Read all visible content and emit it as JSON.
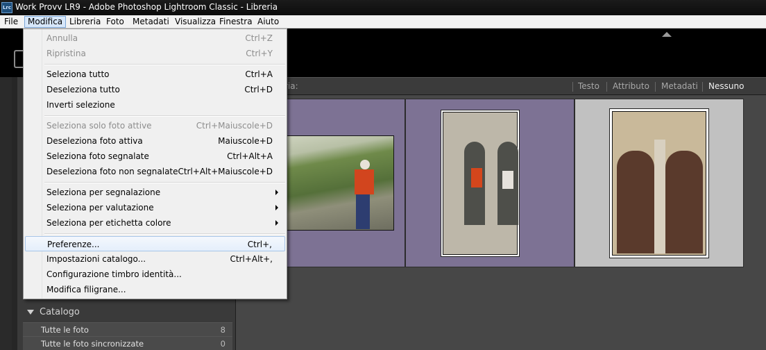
{
  "window": {
    "title": "Work Provv LR9 - Adobe Photoshop Lightroom Classic - Libreria",
    "icon_label": "Lrc"
  },
  "menubar": {
    "items": [
      "File",
      "Modifica",
      "Libreria",
      "Foto",
      "Metadati",
      "Visualizza",
      "Finestra",
      "Aiuto"
    ],
    "open": "Modifica"
  },
  "edit_menu": {
    "undo": {
      "label": "Annulla",
      "shortcut": "Ctrl+Z"
    },
    "redo": {
      "label": "Ripristina",
      "shortcut": "Ctrl+Y"
    },
    "select_all": {
      "label": "Seleziona tutto",
      "shortcut": "Ctrl+A"
    },
    "deselect_all": {
      "label": "Deseleziona tutto",
      "shortcut": "Ctrl+D"
    },
    "invert_selection": {
      "label": "Inverti selezione"
    },
    "select_active_only": {
      "label": "Seleziona solo foto attive",
      "shortcut": "Ctrl+Maiuscole+D"
    },
    "deselect_active": {
      "label": "Deseleziona foto attiva",
      "shortcut": "Maiuscole+D"
    },
    "select_flagged": {
      "label": "Seleziona foto segnalate",
      "shortcut": "Ctrl+Alt+A"
    },
    "deselect_unflagged": {
      "label": "Deseleziona foto non segnalate",
      "shortcut": "Ctrl+Alt+Maiuscole+D"
    },
    "select_by_flag": {
      "label": "Seleziona per segnalazione"
    },
    "select_by_rating": {
      "label": "Seleziona per valutazione"
    },
    "select_by_color": {
      "label": "Seleziona per etichetta colore"
    },
    "preferences": {
      "label": "Preferenze...",
      "shortcut": "Ctrl+,"
    },
    "catalog_settings": {
      "label": "Impostazioni catalogo...",
      "shortcut": "Ctrl+Alt+,"
    },
    "identity_plate": {
      "label": "Configurazione timbro identità..."
    },
    "watermarks": {
      "label": "Modifica filigrane..."
    }
  },
  "filter_bar": {
    "label": "ria:",
    "options": [
      "Testo",
      "Attributo",
      "Metadati",
      "Nessuno"
    ],
    "active": "Nessuno"
  },
  "catalog": {
    "title": "Catalogo",
    "rows": [
      {
        "label": "Tutte le foto",
        "count": "8"
      },
      {
        "label": "Tutte le foto sincronizzate",
        "count": "0"
      }
    ]
  },
  "colors": {
    "selected_cell": "#7d7294",
    "menu_highlight": "#d7e7fa",
    "panel": "#3a3a3a"
  }
}
